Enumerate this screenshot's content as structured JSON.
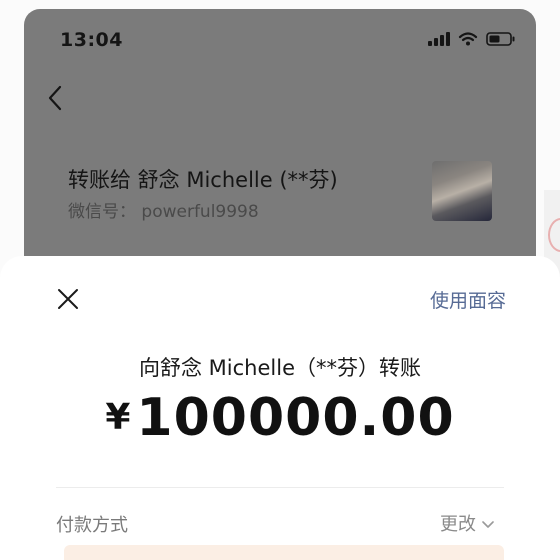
{
  "status_bar": {
    "time": "13:04",
    "icons": [
      "cellular-signal-icon",
      "wifi-icon",
      "battery-icon"
    ]
  },
  "header": {
    "back_icon": "chevron-left-icon"
  },
  "recipient": {
    "title": "转账给 舒念 Michelle (**芬)",
    "wechat_id": "微信号： powerful9998"
  },
  "sheet": {
    "close_icon": "close-icon",
    "face_pay_label": "使用面容",
    "pay_to": "向舒念 Michelle（**芬）转账",
    "currency_symbol": "¥",
    "amount": "100000.00",
    "payment_method_label": "付款方式",
    "change_label": "更改"
  },
  "colors": {
    "link": "#576b95",
    "dim_overlay": "#7b7b7b",
    "sheet_background": "#ffffff"
  }
}
